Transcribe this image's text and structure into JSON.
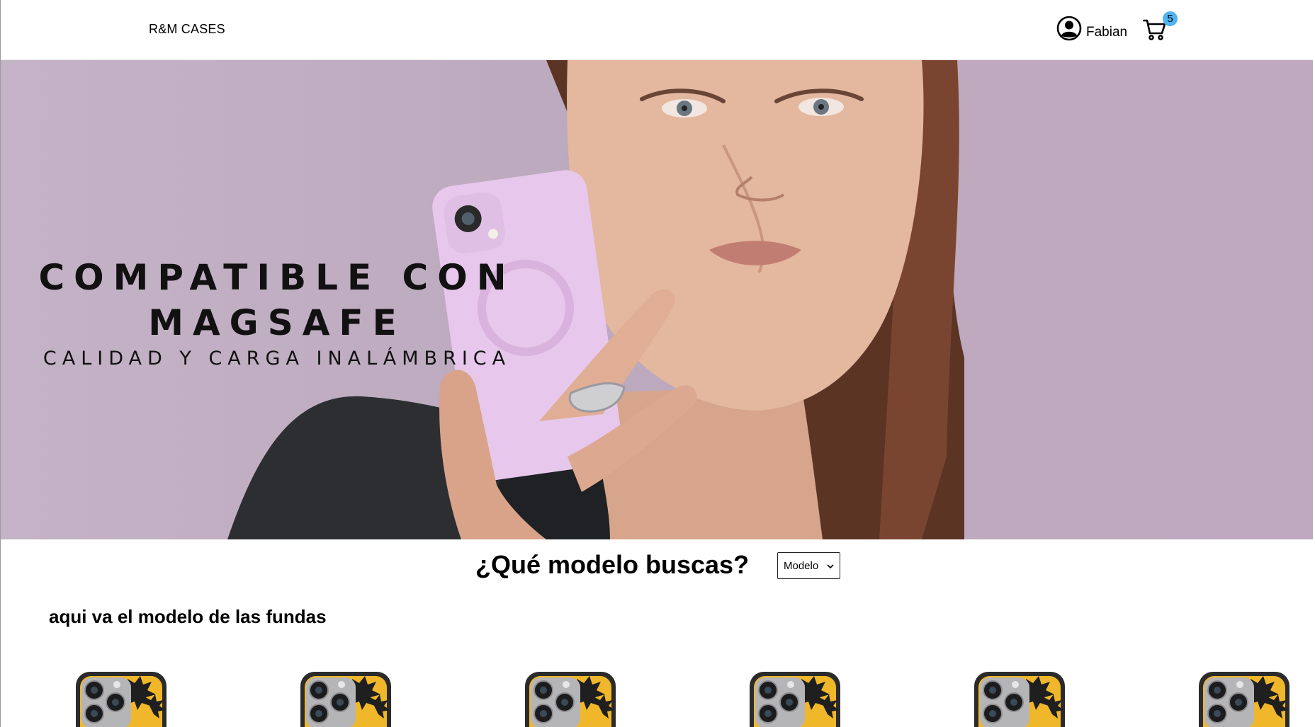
{
  "header": {
    "brand": "R&M CASES",
    "user_name": "Fabian",
    "cart_count": "5",
    "icons": {
      "user": "user-circle-icon",
      "cart": "shopping-cart-icon"
    },
    "badge_color": "#4fb3f0"
  },
  "hero": {
    "title_line1": "COMPATIBLE CON",
    "title_line2": "MAGSAFE",
    "subtitle": "CALIDAD Y CARGA INALÁMBRICA",
    "background_color": "#bfaac0",
    "case_color": "#e7c8ec"
  },
  "search": {
    "title": "¿Qué modelo buscas?",
    "select_value": "Modelo"
  },
  "section": {
    "title": "aqui va el modelo de las fundas"
  },
  "products": [
    {
      "image": "phone-case-image"
    },
    {
      "image": "phone-case-image"
    },
    {
      "image": "phone-case-image"
    },
    {
      "image": "phone-case-image"
    },
    {
      "image": "phone-case-image"
    },
    {
      "image": "phone-case-image"
    }
  ]
}
